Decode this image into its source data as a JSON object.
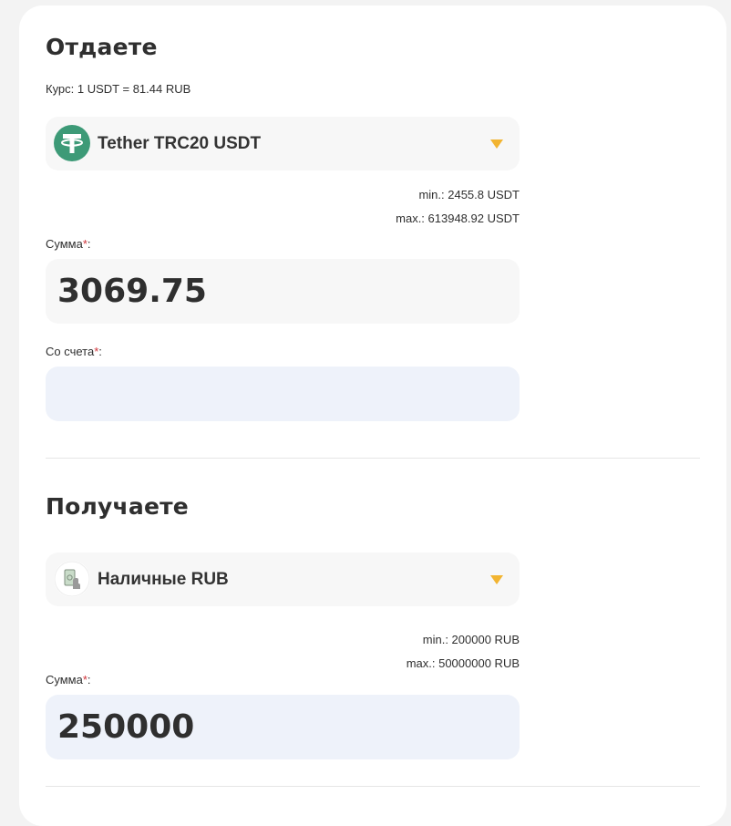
{
  "give": {
    "title": "Отдаете",
    "rate": "Курс: 1 USDT = 81.44 RUB",
    "currency": {
      "label": "Tether TRC20 USDT",
      "icon": "tether-icon",
      "icon_color": "#3d9a77"
    },
    "min": "min.: 2455.8 USDT",
    "max": "max.: 613948.92 USDT",
    "amount_label": "Сумма",
    "amount_value": "3069.75",
    "account_label": "Со счета",
    "account_value": ""
  },
  "receive": {
    "title": "Получаете",
    "currency": {
      "label": "Наличные RUB",
      "icon": "cash-hand-icon"
    },
    "min": "min.: 200000 RUB",
    "max": "max.: 50000000 RUB",
    "amount_label": "Сумма",
    "amount_value": "250000"
  },
  "required_mark": "*",
  "colors": {
    "accent": "#f2b431",
    "required": "#d0343a",
    "field_bg": "#f7f7f7",
    "field_bg_blue": "#eef2fa"
  }
}
